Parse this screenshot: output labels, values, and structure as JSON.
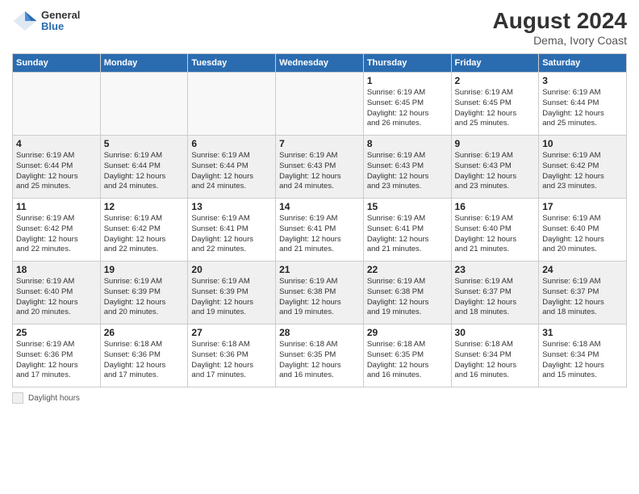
{
  "header": {
    "logo": {
      "general": "General",
      "blue": "Blue"
    },
    "title": "August 2024",
    "location": "Dema, Ivory Coast"
  },
  "days_of_week": [
    "Sunday",
    "Monday",
    "Tuesday",
    "Wednesday",
    "Thursday",
    "Friday",
    "Saturday"
  ],
  "legend": {
    "label": "Daylight hours"
  },
  "weeks": [
    {
      "days": [
        {
          "num": "",
          "info": "",
          "empty": true
        },
        {
          "num": "",
          "info": "",
          "empty": true
        },
        {
          "num": "",
          "info": "",
          "empty": true
        },
        {
          "num": "",
          "info": "",
          "empty": true
        },
        {
          "num": "1",
          "info": "Sunrise: 6:19 AM\nSunset: 6:45 PM\nDaylight: 12 hours\nand 26 minutes.",
          "empty": false
        },
        {
          "num": "2",
          "info": "Sunrise: 6:19 AM\nSunset: 6:45 PM\nDaylight: 12 hours\nand 25 minutes.",
          "empty": false
        },
        {
          "num": "3",
          "info": "Sunrise: 6:19 AM\nSunset: 6:44 PM\nDaylight: 12 hours\nand 25 minutes.",
          "empty": false
        }
      ]
    },
    {
      "days": [
        {
          "num": "4",
          "info": "Sunrise: 6:19 AM\nSunset: 6:44 PM\nDaylight: 12 hours\nand 25 minutes.",
          "empty": false
        },
        {
          "num": "5",
          "info": "Sunrise: 6:19 AM\nSunset: 6:44 PM\nDaylight: 12 hours\nand 24 minutes.",
          "empty": false
        },
        {
          "num": "6",
          "info": "Sunrise: 6:19 AM\nSunset: 6:44 PM\nDaylight: 12 hours\nand 24 minutes.",
          "empty": false
        },
        {
          "num": "7",
          "info": "Sunrise: 6:19 AM\nSunset: 6:43 PM\nDaylight: 12 hours\nand 24 minutes.",
          "empty": false
        },
        {
          "num": "8",
          "info": "Sunrise: 6:19 AM\nSunset: 6:43 PM\nDaylight: 12 hours\nand 23 minutes.",
          "empty": false
        },
        {
          "num": "9",
          "info": "Sunrise: 6:19 AM\nSunset: 6:43 PM\nDaylight: 12 hours\nand 23 minutes.",
          "empty": false
        },
        {
          "num": "10",
          "info": "Sunrise: 6:19 AM\nSunset: 6:42 PM\nDaylight: 12 hours\nand 23 minutes.",
          "empty": false
        }
      ]
    },
    {
      "days": [
        {
          "num": "11",
          "info": "Sunrise: 6:19 AM\nSunset: 6:42 PM\nDaylight: 12 hours\nand 22 minutes.",
          "empty": false
        },
        {
          "num": "12",
          "info": "Sunrise: 6:19 AM\nSunset: 6:42 PM\nDaylight: 12 hours\nand 22 minutes.",
          "empty": false
        },
        {
          "num": "13",
          "info": "Sunrise: 6:19 AM\nSunset: 6:41 PM\nDaylight: 12 hours\nand 22 minutes.",
          "empty": false
        },
        {
          "num": "14",
          "info": "Sunrise: 6:19 AM\nSunset: 6:41 PM\nDaylight: 12 hours\nand 21 minutes.",
          "empty": false
        },
        {
          "num": "15",
          "info": "Sunrise: 6:19 AM\nSunset: 6:41 PM\nDaylight: 12 hours\nand 21 minutes.",
          "empty": false
        },
        {
          "num": "16",
          "info": "Sunrise: 6:19 AM\nSunset: 6:40 PM\nDaylight: 12 hours\nand 21 minutes.",
          "empty": false
        },
        {
          "num": "17",
          "info": "Sunrise: 6:19 AM\nSunset: 6:40 PM\nDaylight: 12 hours\nand 20 minutes.",
          "empty": false
        }
      ]
    },
    {
      "days": [
        {
          "num": "18",
          "info": "Sunrise: 6:19 AM\nSunset: 6:40 PM\nDaylight: 12 hours\nand 20 minutes.",
          "empty": false
        },
        {
          "num": "19",
          "info": "Sunrise: 6:19 AM\nSunset: 6:39 PM\nDaylight: 12 hours\nand 20 minutes.",
          "empty": false
        },
        {
          "num": "20",
          "info": "Sunrise: 6:19 AM\nSunset: 6:39 PM\nDaylight: 12 hours\nand 19 minutes.",
          "empty": false
        },
        {
          "num": "21",
          "info": "Sunrise: 6:19 AM\nSunset: 6:38 PM\nDaylight: 12 hours\nand 19 minutes.",
          "empty": false
        },
        {
          "num": "22",
          "info": "Sunrise: 6:19 AM\nSunset: 6:38 PM\nDaylight: 12 hours\nand 19 minutes.",
          "empty": false
        },
        {
          "num": "23",
          "info": "Sunrise: 6:19 AM\nSunset: 6:37 PM\nDaylight: 12 hours\nand 18 minutes.",
          "empty": false
        },
        {
          "num": "24",
          "info": "Sunrise: 6:19 AM\nSunset: 6:37 PM\nDaylight: 12 hours\nand 18 minutes.",
          "empty": false
        }
      ]
    },
    {
      "days": [
        {
          "num": "25",
          "info": "Sunrise: 6:19 AM\nSunset: 6:36 PM\nDaylight: 12 hours\nand 17 minutes.",
          "empty": false
        },
        {
          "num": "26",
          "info": "Sunrise: 6:18 AM\nSunset: 6:36 PM\nDaylight: 12 hours\nand 17 minutes.",
          "empty": false
        },
        {
          "num": "27",
          "info": "Sunrise: 6:18 AM\nSunset: 6:36 PM\nDaylight: 12 hours\nand 17 minutes.",
          "empty": false
        },
        {
          "num": "28",
          "info": "Sunrise: 6:18 AM\nSunset: 6:35 PM\nDaylight: 12 hours\nand 16 minutes.",
          "empty": false
        },
        {
          "num": "29",
          "info": "Sunrise: 6:18 AM\nSunset: 6:35 PM\nDaylight: 12 hours\nand 16 minutes.",
          "empty": false
        },
        {
          "num": "30",
          "info": "Sunrise: 6:18 AM\nSunset: 6:34 PM\nDaylight: 12 hours\nand 16 minutes.",
          "empty": false
        },
        {
          "num": "31",
          "info": "Sunrise: 6:18 AM\nSunset: 6:34 PM\nDaylight: 12 hours\nand 15 minutes.",
          "empty": false
        }
      ]
    }
  ]
}
